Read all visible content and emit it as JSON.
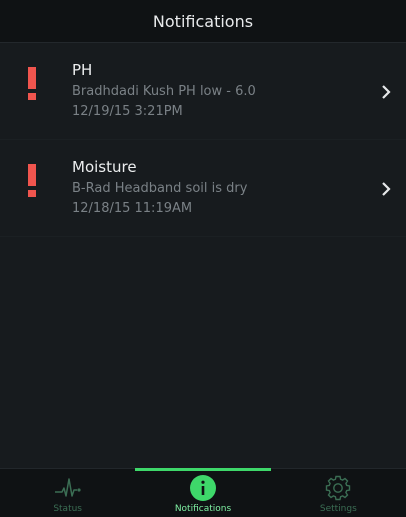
{
  "header": {
    "title": "Notifications"
  },
  "notifications": [
    {
      "title": "PH",
      "message": "Bradhdadi Kush PH low - 6.0",
      "time": "12/19/15 3:21PM"
    },
    {
      "title": "Moisture",
      "message": "B-Rad Headband soil is dry",
      "time": "12/18/15 11:19AM"
    }
  ],
  "tabs": [
    {
      "label": "Status",
      "icon": "heartbeat-icon"
    },
    {
      "label": "Notifications",
      "icon": "info-icon",
      "active": true
    },
    {
      "label": "Settings",
      "icon": "gear-icon"
    }
  ],
  "colors": {
    "alert": "#f0554e",
    "accent": "#3ed86a",
    "tab_inactive": "#3b6e54"
  }
}
